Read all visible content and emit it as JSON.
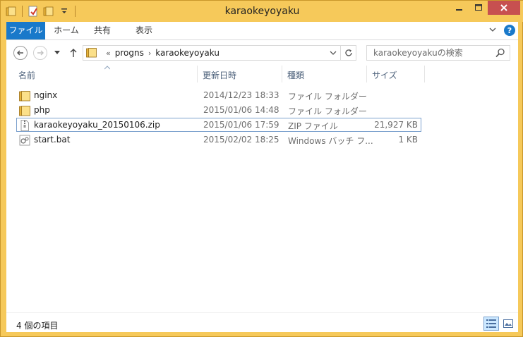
{
  "window": {
    "title": "karaokeyoyaku"
  },
  "ribbon": {
    "tabs": [
      {
        "label": "ファイル"
      },
      {
        "label": "ホーム"
      },
      {
        "label": "共有"
      },
      {
        "label": "表示"
      }
    ]
  },
  "address": {
    "overflow": "«",
    "crumbs": [
      "progns",
      "karaokeyoyaku"
    ]
  },
  "search": {
    "placeholder": "karaokeyoyakuの検索"
  },
  "columns": {
    "name": "名前",
    "date": "更新日時",
    "type": "種類",
    "size": "サイズ"
  },
  "files": [
    {
      "name": "nginx",
      "date": "2014/12/23 18:33",
      "type": "ファイル フォルダー",
      "size": "",
      "icon": "folder-icon"
    },
    {
      "name": "php",
      "date": "2015/01/06 14:48",
      "type": "ファイル フォルダー",
      "size": "",
      "icon": "folder-icon"
    },
    {
      "name": "karaokeyoyaku_20150106.zip",
      "date": "2015/01/06 17:59",
      "type": "ZIP ファイル",
      "size": "21,927 KB",
      "icon": "zip-file-icon",
      "selected": true
    },
    {
      "name": "start.bat",
      "date": "2015/02/02 18:25",
      "type": "Windows バッチ フ...",
      "size": "1 KB",
      "icon": "batch-file-icon"
    }
  ],
  "status": {
    "item_count": "4 個の項目"
  },
  "colors": {
    "frame": "#f6c95a",
    "accent": "#1979ca",
    "close": "#c75050",
    "selection_border": "#7da2ce"
  }
}
